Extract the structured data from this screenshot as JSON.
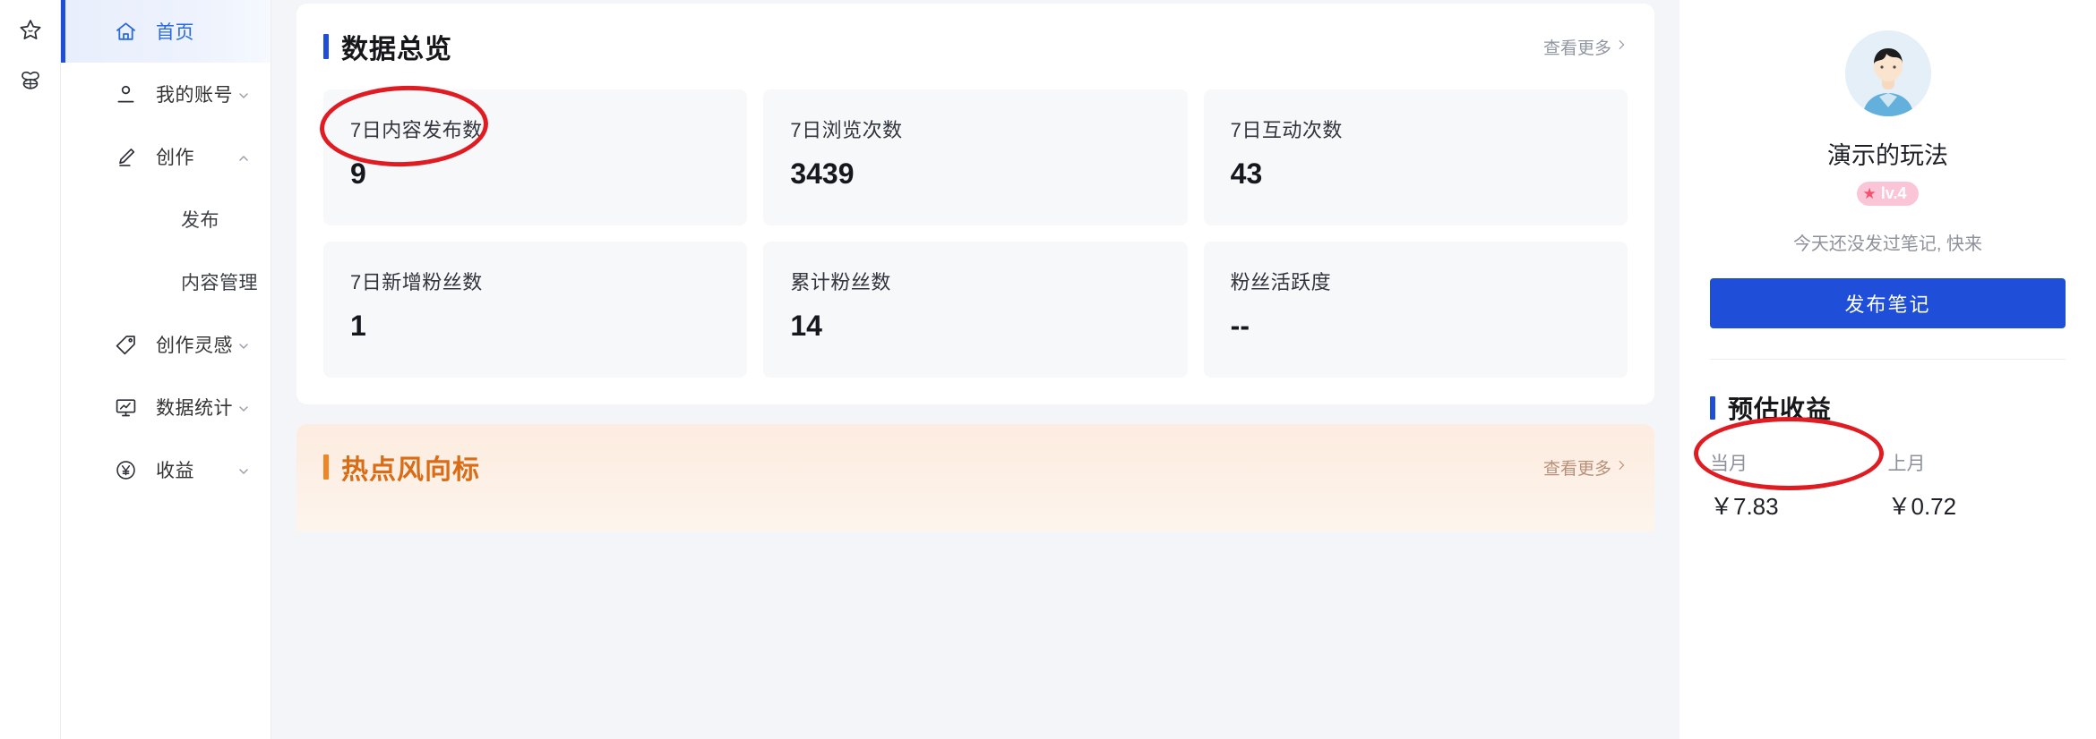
{
  "icon_rail": [
    {
      "name": "favorites-star-icon",
      "label": "收藏"
    },
    {
      "name": "bee-icon",
      "label": "蜂巢"
    }
  ],
  "sidebar": {
    "items": [
      {
        "label": "首页",
        "icon": "home-icon",
        "active": true,
        "expandable": false
      },
      {
        "label": "我的账号",
        "icon": "user-icon",
        "active": false,
        "expandable": true,
        "chevron": "down"
      },
      {
        "label": "创作",
        "icon": "pencil-icon",
        "active": false,
        "expandable": true,
        "chevron": "up"
      },
      {
        "label": "发布",
        "icon": "",
        "sub": true
      },
      {
        "label": "内容管理",
        "icon": "",
        "sub": true
      },
      {
        "label": "创作灵感",
        "icon": "tag-icon",
        "active": false,
        "expandable": true,
        "chevron": "down"
      },
      {
        "label": "数据统计",
        "icon": "monitor-chart-icon",
        "active": false,
        "expandable": true,
        "chevron": "down"
      },
      {
        "label": "收益",
        "icon": "yuan-circle-icon",
        "active": false,
        "expandable": true,
        "chevron": "down"
      }
    ]
  },
  "overview": {
    "title": "数据总览",
    "more_label": "查看更多",
    "stats": [
      {
        "label": "7日内容发布数",
        "value": "9"
      },
      {
        "label": "7日浏览次数",
        "value": "3439"
      },
      {
        "label": "7日互动次数",
        "value": "43"
      },
      {
        "label": "7日新增粉丝数",
        "value": "1"
      },
      {
        "label": "累计粉丝数",
        "value": "14"
      },
      {
        "label": "粉丝活跃度",
        "value": "--"
      }
    ]
  },
  "hotspot": {
    "title": "热点风向标",
    "more_label": "查看更多"
  },
  "profile": {
    "username": "演示的玩法",
    "level_badge": "lv.4",
    "tip": "今天还没发过笔记, 快来",
    "publish_button": "发布笔记"
  },
  "earnings": {
    "title": "预估收益",
    "items": [
      {
        "label": "当月",
        "value": "￥7.83"
      },
      {
        "label": "上月",
        "value": "￥0.72"
      }
    ]
  },
  "colors": {
    "accent_blue": "#1f4ed8",
    "hot_orange": "#ef8524",
    "annotation_red": "#e11b22",
    "level_pink": "#fbc5d8"
  }
}
